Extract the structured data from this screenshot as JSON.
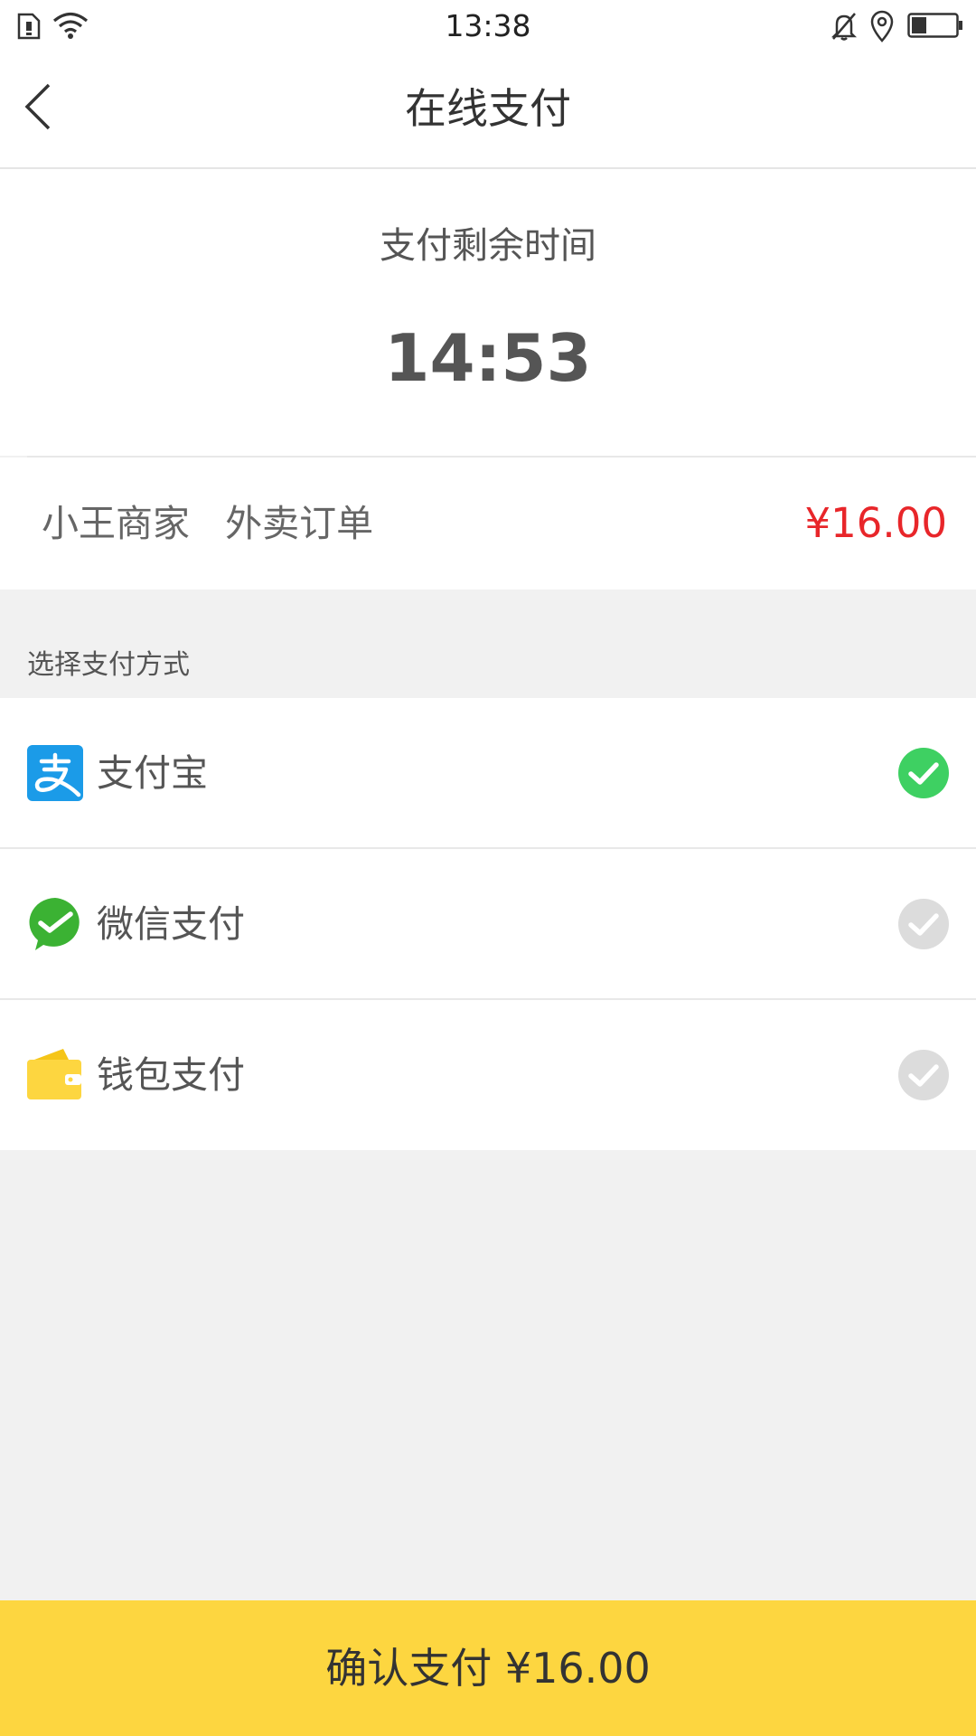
{
  "status_bar": {
    "time": "13:38",
    "icons": [
      "sim-card-icon",
      "wifi-icon",
      "bell-off-icon",
      "location-icon",
      "battery-icon"
    ]
  },
  "header": {
    "title": "在线支付",
    "back_icon": "chevron-left-icon"
  },
  "timer": {
    "label": "支付剩余时间",
    "value": "14:53"
  },
  "order": {
    "merchant": "小王商家",
    "type": "外卖订单",
    "amount": "¥16.00"
  },
  "payment": {
    "section_title": "选择支付方式",
    "options": [
      {
        "label": "支付宝",
        "icon": "alipay-icon",
        "selected": true
      },
      {
        "label": "微信支付",
        "icon": "wechat-pay-icon",
        "selected": false
      },
      {
        "label": "钱包支付",
        "icon": "wallet-icon",
        "selected": false
      }
    ]
  },
  "confirm": {
    "label": "确认支付 ¥16.00"
  },
  "colors": {
    "accent_yellow": "#fdd640",
    "price_red": "#e8262a",
    "check_selected": "#3ed062",
    "check_unselected": "#dcdcdc",
    "alipay_blue": "#1b9be8",
    "wechat_green": "#3bb233",
    "wallet_yellow": "#fdd640"
  }
}
